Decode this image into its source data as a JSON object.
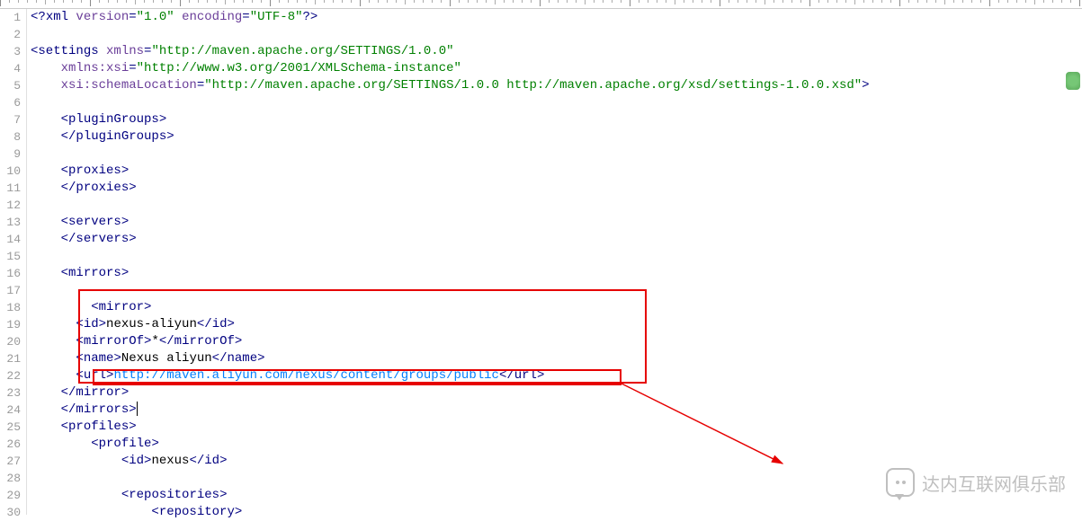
{
  "ruler": {
    "count": 12,
    "spacing_px": 100
  },
  "watermark": {
    "text": "达内互联网俱乐部"
  },
  "code": {
    "lines": [
      {
        "n": 1,
        "segs": [
          {
            "cls": "t-punct",
            "t": "<?"
          },
          {
            "cls": "t-tag",
            "t": "xml "
          },
          {
            "cls": "t-attr",
            "t": "version"
          },
          {
            "cls": "t-punct",
            "t": "="
          },
          {
            "cls": "t-str",
            "t": "\"1.0\""
          },
          {
            "cls": "t-text",
            "t": " "
          },
          {
            "cls": "t-attr",
            "t": "encoding"
          },
          {
            "cls": "t-punct",
            "t": "="
          },
          {
            "cls": "t-str",
            "t": "\"UTF-8\""
          },
          {
            "cls": "t-punct",
            "t": "?>"
          }
        ]
      },
      {
        "n": 2,
        "segs": []
      },
      {
        "n": 3,
        "segs": [
          {
            "cls": "t-punct",
            "t": "<"
          },
          {
            "cls": "t-tag",
            "t": "settings "
          },
          {
            "cls": "t-attr",
            "t": "xmlns"
          },
          {
            "cls": "t-punct",
            "t": "="
          },
          {
            "cls": "t-str",
            "t": "\"http://maven.apache.org/SETTINGS/1.0.0\""
          }
        ]
      },
      {
        "n": 4,
        "indent": "    ",
        "segs": [
          {
            "cls": "t-attr",
            "t": "xmlns:xsi"
          },
          {
            "cls": "t-punct",
            "t": "="
          },
          {
            "cls": "t-str",
            "t": "\"http://www.w3.org/2001/XMLSchema-instance\""
          }
        ]
      },
      {
        "n": 5,
        "indent": "    ",
        "segs": [
          {
            "cls": "t-attr",
            "t": "xsi:schemaLocation"
          },
          {
            "cls": "t-punct",
            "t": "="
          },
          {
            "cls": "t-str",
            "t": "\"http://maven.apache.org/SETTINGS/1.0.0 http://maven.apache.org/xsd/settings-1.0.0.xsd\""
          },
          {
            "cls": "t-punct",
            "t": ">"
          }
        ]
      },
      {
        "n": 6,
        "segs": []
      },
      {
        "n": 7,
        "indent": "    ",
        "segs": [
          {
            "cls": "t-punct",
            "t": "<"
          },
          {
            "cls": "t-tag",
            "t": "pluginGroups"
          },
          {
            "cls": "t-punct",
            "t": ">"
          }
        ]
      },
      {
        "n": 8,
        "indent": "    ",
        "segs": [
          {
            "cls": "t-punct",
            "t": "</"
          },
          {
            "cls": "t-tag",
            "t": "pluginGroups"
          },
          {
            "cls": "t-punct",
            "t": ">"
          }
        ]
      },
      {
        "n": 9,
        "segs": []
      },
      {
        "n": 10,
        "indent": "    ",
        "segs": [
          {
            "cls": "t-punct",
            "t": "<"
          },
          {
            "cls": "t-tag",
            "t": "proxies"
          },
          {
            "cls": "t-punct",
            "t": ">"
          }
        ]
      },
      {
        "n": 11,
        "indent": "    ",
        "segs": [
          {
            "cls": "t-punct",
            "t": "</"
          },
          {
            "cls": "t-tag",
            "t": "proxies"
          },
          {
            "cls": "t-punct",
            "t": ">"
          }
        ]
      },
      {
        "n": 12,
        "segs": []
      },
      {
        "n": 13,
        "indent": "    ",
        "segs": [
          {
            "cls": "t-punct",
            "t": "<"
          },
          {
            "cls": "t-tag",
            "t": "servers"
          },
          {
            "cls": "t-punct",
            "t": ">"
          }
        ]
      },
      {
        "n": 14,
        "indent": "    ",
        "segs": [
          {
            "cls": "t-punct",
            "t": "</"
          },
          {
            "cls": "t-tag",
            "t": "servers"
          },
          {
            "cls": "t-punct",
            "t": ">"
          }
        ]
      },
      {
        "n": 15,
        "segs": []
      },
      {
        "n": 16,
        "indent": "    ",
        "segs": [
          {
            "cls": "t-punct",
            "t": "<"
          },
          {
            "cls": "t-tag",
            "t": "mirrors"
          },
          {
            "cls": "t-punct",
            "t": ">"
          }
        ]
      },
      {
        "n": 17,
        "segs": []
      },
      {
        "n": 18,
        "indent": "        ",
        "segs": [
          {
            "cls": "t-punct",
            "t": "<"
          },
          {
            "cls": "t-tag",
            "t": "mirror"
          },
          {
            "cls": "t-punct",
            "t": ">"
          }
        ]
      },
      {
        "n": 19,
        "indent": "      ",
        "segs": [
          {
            "cls": "t-punct",
            "t": "<"
          },
          {
            "cls": "t-tag",
            "t": "id"
          },
          {
            "cls": "t-punct",
            "t": ">"
          },
          {
            "cls": "t-text",
            "t": "nexus-aliyun"
          },
          {
            "cls": "t-punct",
            "t": "</"
          },
          {
            "cls": "t-tag",
            "t": "id"
          },
          {
            "cls": "t-punct",
            "t": ">"
          }
        ]
      },
      {
        "n": 20,
        "indent": "      ",
        "segs": [
          {
            "cls": "t-punct",
            "t": "<"
          },
          {
            "cls": "t-tag",
            "t": "mirrorOf"
          },
          {
            "cls": "t-punct",
            "t": ">"
          },
          {
            "cls": "t-text",
            "t": "*"
          },
          {
            "cls": "t-punct",
            "t": "</"
          },
          {
            "cls": "t-tag",
            "t": "mirrorOf"
          },
          {
            "cls": "t-punct",
            "t": ">"
          }
        ]
      },
      {
        "n": 21,
        "indent": "      ",
        "segs": [
          {
            "cls": "t-punct",
            "t": "<"
          },
          {
            "cls": "t-tag",
            "t": "name"
          },
          {
            "cls": "t-punct",
            "t": ">"
          },
          {
            "cls": "t-text",
            "t": "Nexus aliyun"
          },
          {
            "cls": "t-punct",
            "t": "</"
          },
          {
            "cls": "t-tag",
            "t": "name"
          },
          {
            "cls": "t-punct",
            "t": ">"
          }
        ]
      },
      {
        "n": 22,
        "indent": "      ",
        "segs": [
          {
            "cls": "t-punct",
            "t": "<"
          },
          {
            "cls": "t-tag",
            "t": "url"
          },
          {
            "cls": "t-punct",
            "t": ">"
          },
          {
            "cls": "t-url",
            "t": "http://maven.aliyun.com/nexus/content/groups/public"
          },
          {
            "cls": "t-punct",
            "t": "</"
          },
          {
            "cls": "t-tag",
            "t": "url"
          },
          {
            "cls": "t-punct",
            "t": ">"
          }
        ]
      },
      {
        "n": 23,
        "indent": "    ",
        "segs": [
          {
            "cls": "t-punct",
            "t": "</"
          },
          {
            "cls": "t-tag",
            "t": "mirror"
          },
          {
            "cls": "t-punct",
            "t": ">"
          }
        ]
      },
      {
        "n": 24,
        "indent": "    ",
        "segs": [
          {
            "cls": "t-punct",
            "t": "</"
          },
          {
            "cls": "t-tag",
            "t": "mirrors"
          },
          {
            "cls": "t-punct",
            "t": ">"
          }
        ],
        "caret": true
      },
      {
        "n": 25,
        "indent": "    ",
        "segs": [
          {
            "cls": "t-punct",
            "t": "<"
          },
          {
            "cls": "t-tag",
            "t": "profiles"
          },
          {
            "cls": "t-punct",
            "t": ">"
          }
        ]
      },
      {
        "n": 26,
        "indent": "        ",
        "segs": [
          {
            "cls": "t-punct",
            "t": "<"
          },
          {
            "cls": "t-tag",
            "t": "profile"
          },
          {
            "cls": "t-punct",
            "t": ">"
          }
        ]
      },
      {
        "n": 27,
        "indent": "            ",
        "segs": [
          {
            "cls": "t-punct",
            "t": "<"
          },
          {
            "cls": "t-tag",
            "t": "id"
          },
          {
            "cls": "t-punct",
            "t": ">"
          },
          {
            "cls": "t-text",
            "t": "nexus"
          },
          {
            "cls": "t-punct",
            "t": "</"
          },
          {
            "cls": "t-tag",
            "t": "id"
          },
          {
            "cls": "t-punct",
            "t": ">"
          }
        ]
      },
      {
        "n": 28,
        "segs": []
      },
      {
        "n": 29,
        "indent": "            ",
        "segs": [
          {
            "cls": "t-punct",
            "t": "<"
          },
          {
            "cls": "t-tag",
            "t": "repositories"
          },
          {
            "cls": "t-punct",
            "t": ">"
          }
        ]
      },
      {
        "n": 30,
        "indent": "                ",
        "segs": [
          {
            "cls": "t-punct",
            "t": "<"
          },
          {
            "cls": "t-tag",
            "t": "repository"
          },
          {
            "cls": "t-punct",
            "t": ">"
          }
        ]
      }
    ]
  }
}
